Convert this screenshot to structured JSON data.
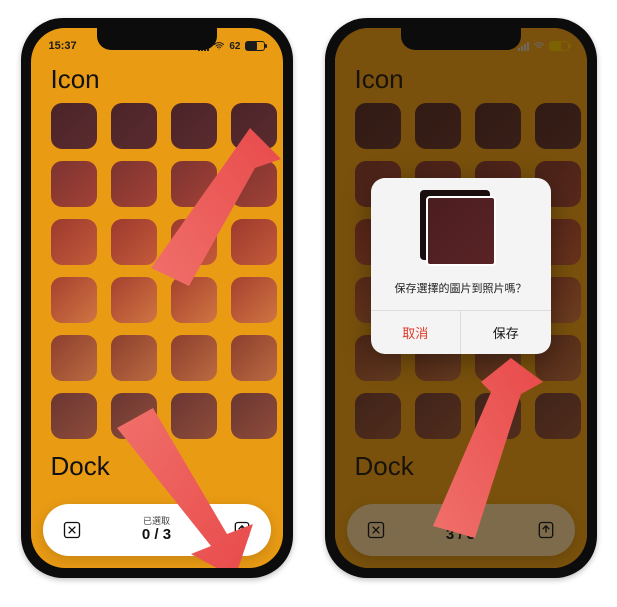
{
  "left": {
    "status": {
      "time": "15:37",
      "battery_text": "62"
    },
    "section_icon": "Icon",
    "section_dock": "Dock",
    "bottom": {
      "label": "已選取",
      "count": "0 / 3"
    }
  },
  "right": {
    "status": {
      "time": "",
      "battery_text": ""
    },
    "section_icon": "Icon",
    "section_dock": "Dock",
    "bottom": {
      "label": "已選取",
      "count": "3 / 3"
    },
    "dialog": {
      "message": "保存選擇的圖片到照片嗎？",
      "cancel": "取消",
      "save": "保存"
    }
  }
}
